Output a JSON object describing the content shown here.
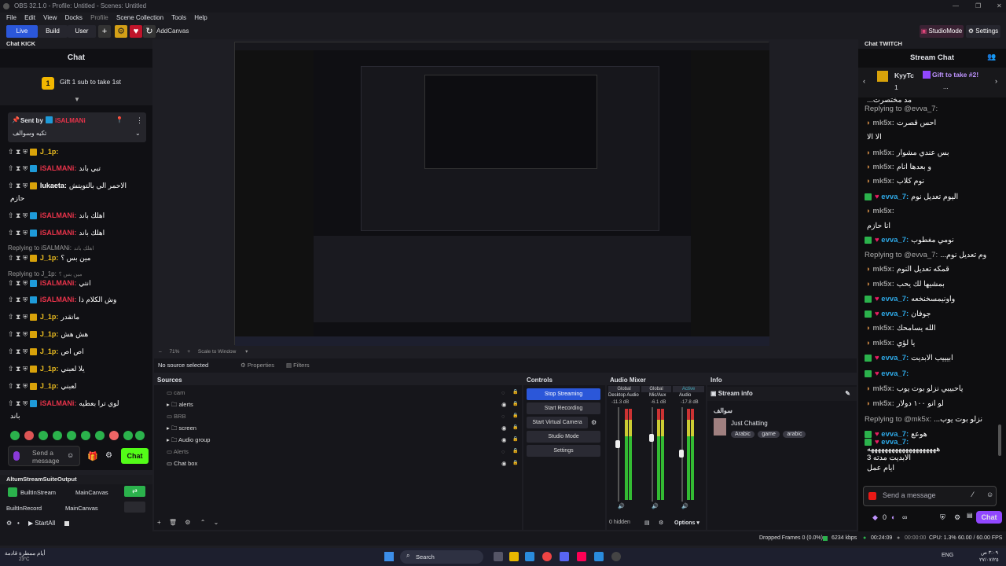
{
  "window": {
    "title": "OBS 32.1.0 - Profile: Untitled - Scenes: Untitled"
  },
  "menu": [
    "File",
    "Edit",
    "View",
    "Docks",
    "Profile",
    "Scene Collection",
    "Tools",
    "Help"
  ],
  "toolbar": {
    "live": "Live",
    "build": "Build",
    "user": "User",
    "add_canvas": "AddCanvas",
    "studio_mode": "StudioMode",
    "settings": "Settings"
  },
  "kick": {
    "dock_title": "Chat KICK",
    "header": "Chat",
    "gift_count": "1",
    "gift_text": "Gift 1 sub to take 1st",
    "pinned_sent_by": "Sent by",
    "pinned_user": "iSALMANi",
    "pinned_message": "تكيه وسوالف",
    "messages": [
      {
        "user": "J_1p:",
        "text": "",
        "color": "#f0c020"
      },
      {
        "user": "iSALMANi:",
        "text": "تبي باند",
        "color": "#e8334a"
      },
      {
        "user": "lukaeta:",
        "text": "الاحمر الي بالتويتش",
        "color": "#ffffff"
      },
      {
        "user": "",
        "text": "حازم",
        "color": "#ffffff"
      },
      {
        "user": "iSALMANi:",
        "text": "اهلك باند",
        "color": "#e8334a"
      },
      {
        "user": "iSALMANi:",
        "text": "اهلك باند",
        "color": "#e8334a"
      },
      {
        "user": "Replying to iSALMANi:",
        "text": "اهلك باند",
        "color": "#9a9a9a"
      },
      {
        "user": "J_1p:",
        "text": "مين بس ؟",
        "color": "#f0c020"
      },
      {
        "user": "Replying to J_1p:",
        "text": "مين بس ؟",
        "color": "#9a9a9a"
      },
      {
        "user": "iSALMANi:",
        "text": "انتي",
        "color": "#e8334a"
      },
      {
        "user": "iSALMANi:",
        "text": "وش الكلام ذا",
        "color": "#e8334a"
      },
      {
        "user": "J_1p:",
        "text": "ماتقدر",
        "color": "#f0c020"
      },
      {
        "user": "J_1p:",
        "text": "هش هش",
        "color": "#f0c020"
      },
      {
        "user": "J_1p:",
        "text": "اص اص",
        "color": "#f0c020"
      },
      {
        "user": "J_1p:",
        "text": "يلا لعبني",
        "color": "#f0c020"
      },
      {
        "user": "J_1p:",
        "text": "لعبني",
        "color": "#f0c020"
      },
      {
        "user": "iSALMANi:",
        "text": "لوي ترا بعطيه",
        "color": "#e8334a"
      },
      {
        "user": "",
        "text": "باند",
        "color": "#ffffff"
      }
    ],
    "send_placeholder": "Send a message",
    "chat_button": "Chat"
  },
  "altum": {
    "title": "AltumStreamSuiteOutput",
    "rows": [
      {
        "name": "BuiltInStream",
        "canvas": "MainCanvas"
      },
      {
        "name": "BuiltInRecord",
        "canvas": "MainCanvas"
      }
    ],
    "start_all": "StartAll"
  },
  "preview": {
    "zoom": "71%",
    "scale_label": "Scale to Window"
  },
  "props_bar": {
    "no_source": "No source selected",
    "properties": "Properties",
    "filters": "Filters"
  },
  "sources": {
    "title": "Sources",
    "items": [
      {
        "name": "cam",
        "group": false,
        "dim": true
      },
      {
        "name": "alerts",
        "group": true,
        "dim": false
      },
      {
        "name": "BRB",
        "group": false,
        "dim": true
      },
      {
        "name": "screen",
        "group": true,
        "dim": false
      },
      {
        "name": "Audio group",
        "group": true,
        "dim": false
      },
      {
        "name": "Alerts",
        "group": false,
        "dim": true
      },
      {
        "name": "Chat box",
        "group": false,
        "dim": false
      }
    ]
  },
  "controls": {
    "title": "Controls",
    "buttons": [
      "Stop Streaming",
      "Start Recording",
      "Start Virtual Camera",
      "Studio Mode",
      "Settings"
    ]
  },
  "mixer": {
    "title": "Audio Mixer",
    "tabs": [
      "Global",
      "Global",
      "Active"
    ],
    "channels": [
      {
        "name": "Desktop Audio",
        "db": "-11.3 dB"
      },
      {
        "name": "Mic/Aux",
        "db": "-6.1 dB"
      },
      {
        "name": "Audio",
        "db": "-17.8 dB"
      }
    ],
    "hidden": "0 hidden",
    "options": "Options"
  },
  "info": {
    "title": "Info",
    "stream_info": "Stream info",
    "channel": "سوالف",
    "category": "Just Chatting",
    "tags": [
      "Arabic",
      "game",
      "arabic"
    ]
  },
  "twitch": {
    "dock_title": "Chat TWITCH",
    "header": "Stream Chat",
    "gift_user": "KyyTc",
    "gift_text": "Gift to take #2!",
    "gift_count": "1",
    "messages": [
      {
        "user": "",
        "text": "...مد مختصرت",
        "color": "#ffffff"
      },
      {
        "user": "Replying to @evva_7:",
        "text": "",
        "color": "#aaaaaa"
      },
      {
        "user": "mk5x:",
        "text": "احس قصرت",
        "color": "#999999"
      },
      {
        "user": "",
        "text": "الا الا",
        "color": "#ffffff"
      },
      {
        "user": "mk5x:",
        "text": "بس عندي مشوار",
        "color": "#999999"
      },
      {
        "user": "mk5x:",
        "text": "و بعدها انام",
        "color": "#999999"
      },
      {
        "user": "mk5x:",
        "text": "نوم كلاب",
        "color": "#999999"
      },
      {
        "user": "evva_7:",
        "text": "اليوم تعديل نوم",
        "color": "#2ea8e6"
      },
      {
        "user": "mk5x:",
        "text": "",
        "color": "#999999"
      },
      {
        "user": "",
        "text": "انا حازم",
        "color": "#ffffff"
      },
      {
        "user": "evva_7:",
        "text": "نومي مغطوب",
        "color": "#2ea8e6"
      },
      {
        "user": "Replying to @evva_7:",
        "text": "...وم تعديل نوم",
        "color": "#aaaaaa"
      },
      {
        "user": "mk5x:",
        "text": "قمكه تعديل النوم",
        "color": "#999999"
      },
      {
        "user": "mk5x:",
        "text": "بمشيها لك يحب",
        "color": "#999999"
      },
      {
        "user": "evva_7:",
        "text": "واونيمسخنخعه",
        "color": "#2ea8e6"
      },
      {
        "user": "evva_7:",
        "text": "جوفان",
        "color": "#2ea8e6"
      },
      {
        "user": "mk5x:",
        "text": "الله يسامحك",
        "color": "#999999"
      },
      {
        "user": "mk5x:",
        "text": "يا لؤي",
        "color": "#999999"
      },
      {
        "user": "evva_7:",
        "text": "ابيييب الابديت",
        "color": "#2ea8e6"
      },
      {
        "user": "evva_7:",
        "text": "",
        "color": "#2ea8e6"
      },
      {
        "user": "mk5x:",
        "text": "ياحبيبي نزلو بوت يوب",
        "color": "#999999"
      },
      {
        "user": "mk5x:",
        "text": "لو انو ١٠٠ دولار",
        "color": "#999999"
      },
      {
        "user": "Replying to @mk5x:",
        "text": "...نزلو بوت يوب",
        "color": "#aaaaaa"
      },
      {
        "user": "evva_7:",
        "text": "هوعع",
        "color": "#2ea8e6"
      },
      {
        "user": "evva_7:",
        "text": "",
        "color": "#2ea8e6"
      },
      {
        "user": "",
        "text": "ههههههههههههههههههههه",
        "color": "#ffffff"
      },
      {
        "user": "",
        "text": "الابديت مدته 3",
        "color": "#ffffff"
      },
      {
        "user": "",
        "text": "ايام عمل",
        "color": "#ffffff"
      }
    ],
    "send_placeholder": "Send a message",
    "points": "0",
    "chat_button": "Chat"
  },
  "statusbar": {
    "dropped": "Dropped Frames 0 (0.0%)",
    "kbps": "6234 kbps",
    "live_time": "00:24:09",
    "rec_time": "00:00:00",
    "cpu": "CPU: 1.3%",
    "fps": "60.00 / 60.00 FPS"
  },
  "taskbar": {
    "weather": "أيام ممطرة قادمة",
    "temp": "23°C",
    "search": "Search",
    "lang": "ENG",
    "time": "٣:٠٩ ص",
    "date": "٢٧/٠٧/٢٥"
  },
  "colors": {
    "accent": "#2b57d9",
    "kick_green": "#53fc18",
    "twitch_purple": "#9147ff",
    "red": "#e8334a"
  }
}
